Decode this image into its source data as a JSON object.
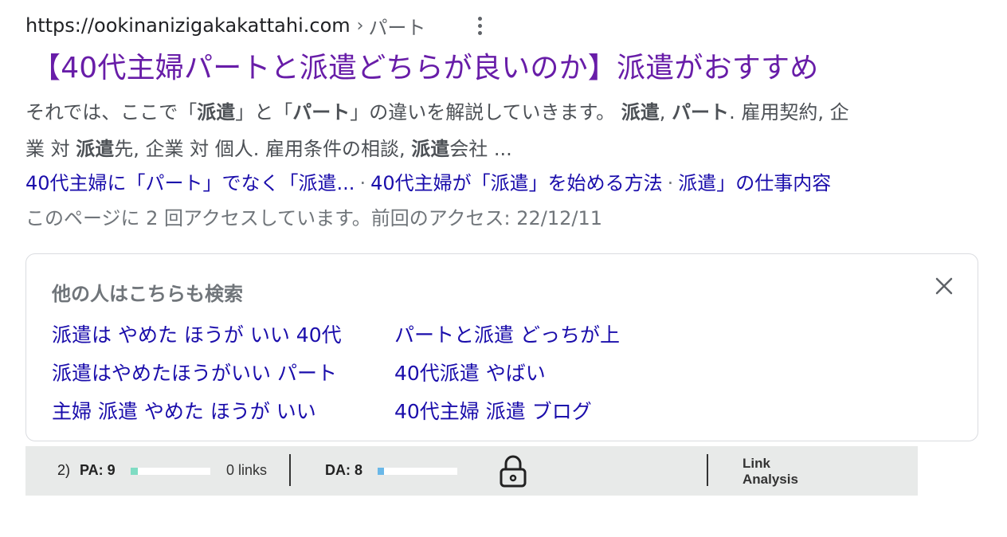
{
  "result": {
    "url": "https://ookinanizigakakattahi.com",
    "breadcrumb_sep": "›",
    "breadcrumb": "パート",
    "title": "【40代主婦パートと派遣どちらが良いのか】派遣がおすすめ",
    "snippet": {
      "line1": [
        {
          "t": "それでは、ここで「",
          "b": false
        },
        {
          "t": "派遣",
          "b": true
        },
        {
          "t": "」と「",
          "b": false
        },
        {
          "t": "パート",
          "b": true
        },
        {
          "t": "」の違いを解説していきます。 ",
          "b": false
        },
        {
          "t": "派遣",
          "b": true
        },
        {
          "t": ", ",
          "b": false
        },
        {
          "t": "パート",
          "b": true
        },
        {
          "t": ". 雇用契約, 企",
          "b": false
        }
      ],
      "line2": [
        {
          "t": "業 対 ",
          "b": false
        },
        {
          "t": "派遣",
          "b": true
        },
        {
          "t": "先, 企業 対 個人. 雇用条件の相談, ",
          "b": false
        },
        {
          "t": "派遣",
          "b": true
        },
        {
          "t": "会社 ...",
          "b": false
        }
      ]
    },
    "sitelinks": [
      "40代主婦に「パート」でなく「派遣...",
      "40代主婦が「派遣」を始める方法",
      "派遣」の仕事内容"
    ],
    "sitelink_sep": "·",
    "visited": "このページに 2 回アクセスしています。前回のアクセス: 22/12/11"
  },
  "people_also_search": {
    "title": "他の人はこちらも検索",
    "items": [
      "派遣は やめた ほうが いい 40代",
      "パートと派遣 どっちが上",
      "派遣はやめたほうがいい パート",
      "40代派遣 やばい",
      "主婦 派遣 やめた ほうが いい",
      "40代主婦 派遣 ブログ"
    ]
  },
  "moz_bar": {
    "index": "2)",
    "pa_label": "PA: 9",
    "pa_value": 9,
    "links": "0 links",
    "da_label": "DA: 8",
    "da_value": 8,
    "link_analysis_line1": "Link",
    "link_analysis_line2": "Analysis",
    "pa_color": "#7fdcc3",
    "da_color": "#6ab8e8"
  }
}
